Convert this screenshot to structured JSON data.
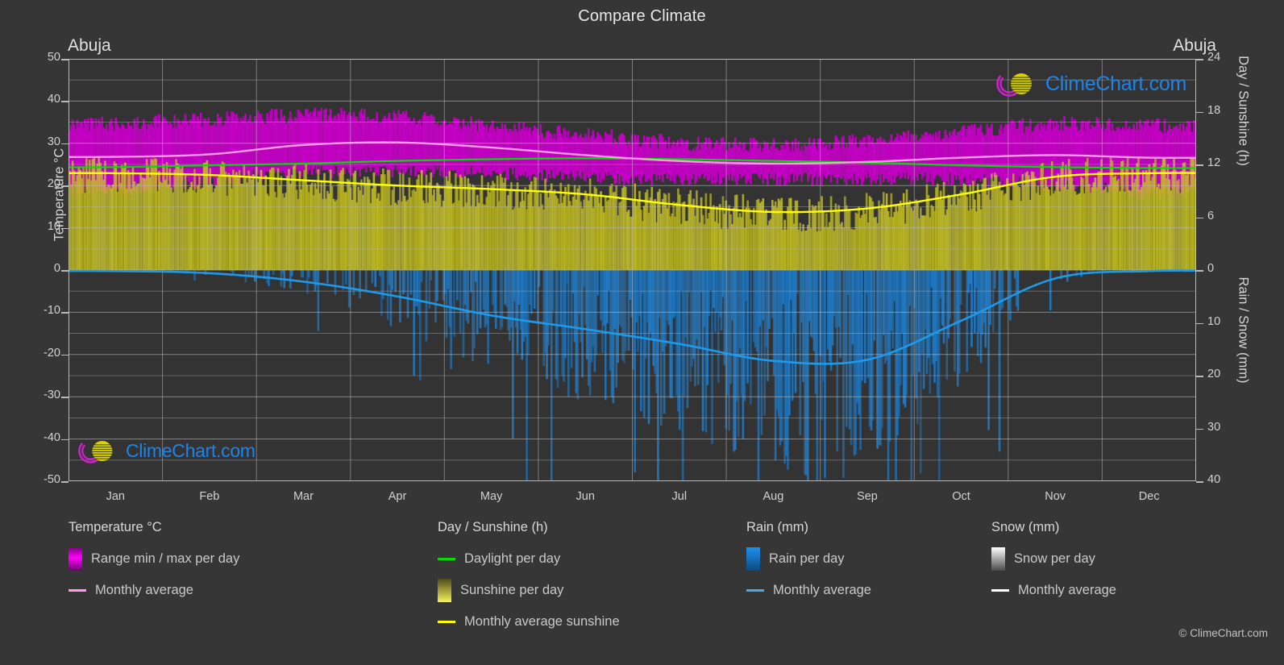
{
  "title": "Compare Climate",
  "city_left": "Abuja",
  "city_right": "Abuja",
  "copyright": "© ClimeChart.com",
  "watermark": {
    "text": "ClimeChart.com",
    "arc_color": "#d41fd4",
    "sphere_color": "#d8d800",
    "text_color": "#1f84e8"
  },
  "axes": {
    "left_label": "Temperature °C",
    "right_label_top": "Day / Sunshine (h)",
    "right_label_bottom": "Rain / Snow (mm)",
    "left_ticks": [
      "50",
      "40",
      "30",
      "20",
      "10",
      "0",
      "-10",
      "-20",
      "-30",
      "-40",
      "-50"
    ],
    "right_ticks_top": [
      "24",
      "18",
      "12",
      "6",
      "0"
    ],
    "right_ticks_bottom": [
      "10",
      "20",
      "30",
      "40"
    ],
    "x_ticks": [
      "Jan",
      "Feb",
      "Mar",
      "Apr",
      "May",
      "Jun",
      "Jul",
      "Aug",
      "Sep",
      "Oct",
      "Nov",
      "Dec"
    ]
  },
  "legend": {
    "temperature": {
      "heading": "Temperature °C",
      "items": [
        {
          "label": "Range min / max per day",
          "type": "swatch",
          "color": "#ff00ff"
        },
        {
          "label": "Monthly average",
          "type": "line",
          "color": "#ff9ae8"
        }
      ]
    },
    "day_sunshine": {
      "heading": "Day / Sunshine (h)",
      "items": [
        {
          "label": "Daylight per day",
          "type": "line",
          "color": "#00e800"
        },
        {
          "label": "Sunshine per day",
          "type": "swatch",
          "color": "#f0ee4a"
        },
        {
          "label": "Monthly average sunshine",
          "type": "line",
          "color": "#ffff00"
        }
      ]
    },
    "rain": {
      "heading": "Rain (mm)",
      "items": [
        {
          "label": "Rain per day",
          "type": "swatch",
          "color": "#1f90f0"
        },
        {
          "label": "Monthly average",
          "type": "line",
          "color": "#4aa8e8"
        }
      ]
    },
    "snow": {
      "heading": "Snow (mm)",
      "items": [
        {
          "label": "Snow per day",
          "type": "swatch",
          "color": "#f2f2f2"
        },
        {
          "label": "Monthly average",
          "type": "line",
          "color": "#ffffff"
        }
      ]
    }
  },
  "chart_data": {
    "type": "area",
    "title": "Compare Climate",
    "location": "Abuja",
    "xlabel": "",
    "ylabel": "Temperature °C",
    "ylim": [
      -50,
      50
    ],
    "y2lim_top_hours": [
      0,
      24
    ],
    "y2lim_bottom_mm": [
      0,
      40
    ],
    "grid": true,
    "legend_position": "below",
    "categories": [
      "Jan",
      "Feb",
      "Mar",
      "Apr",
      "May",
      "Jun",
      "Jul",
      "Aug",
      "Sep",
      "Oct",
      "Nov",
      "Dec"
    ],
    "series": [
      {
        "name": "Monthly average temperature",
        "unit": "°C",
        "color": "#ff9ae8",
        "values": [
          26.8,
          27.4,
          29.6,
          30.2,
          29.0,
          27.2,
          25.8,
          25.2,
          25.6,
          26.6,
          27.2,
          26.6
        ]
      },
      {
        "name": "Daily max temperature (range top)",
        "unit": "°C",
        "color": "#ff00ff",
        "values": [
          34.5,
          35.5,
          36.5,
          36.0,
          34.0,
          32.0,
          30.0,
          29.5,
          30.5,
          32.5,
          34.5,
          34.0
        ]
      },
      {
        "name": "Daily min temperature (range bottom)",
        "unit": "°C",
        "color": "#ff00ff",
        "values": [
          19.0,
          21.0,
          23.0,
          23.5,
          23.0,
          22.0,
          21.5,
          21.5,
          21.5,
          21.5,
          20.0,
          18.5
        ]
      },
      {
        "name": "Daylight per day",
        "unit": "h",
        "color": "#00e800",
        "values": [
          11.7,
          11.9,
          12.1,
          12.4,
          12.6,
          12.7,
          12.6,
          12.4,
          12.2,
          11.9,
          11.7,
          11.6
        ]
      },
      {
        "name": "Monthly average sunshine",
        "unit": "h",
        "color": "#ffff00",
        "values": [
          11.0,
          10.8,
          10.2,
          9.6,
          9.2,
          8.6,
          7.4,
          6.6,
          7.0,
          8.6,
          10.6,
          11.0
        ]
      },
      {
        "name": "Rain monthly average",
        "unit": "mm",
        "color": "#4aa8e8",
        "values": [
          0.2,
          0.6,
          2.2,
          5.0,
          8.6,
          11.2,
          14.0,
          17.2,
          17.0,
          9.6,
          1.6,
          0.2
        ]
      },
      {
        "name": "Snow monthly average",
        "unit": "mm",
        "color": "#ffffff",
        "values": [
          0,
          0,
          0,
          0,
          0,
          0,
          0,
          0,
          0,
          0,
          0,
          0
        ]
      }
    ]
  }
}
